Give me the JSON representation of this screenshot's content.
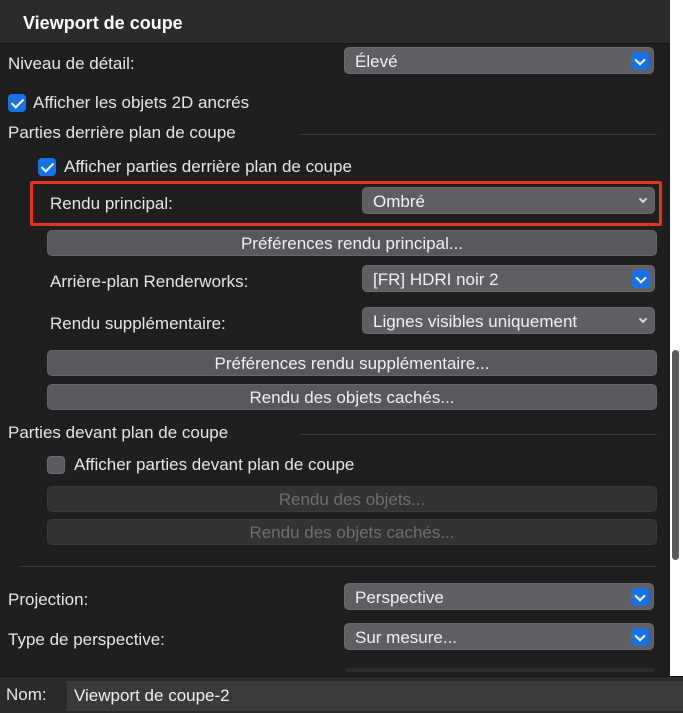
{
  "header": {
    "title": "Viewport de coupe"
  },
  "detail": {
    "label": "Niveau de détail:",
    "value": "Élevé"
  },
  "show_2d": {
    "label": "Afficher les objets 2D ancrés",
    "checked": true
  },
  "behind": {
    "section_label": "Parties derrière plan de coupe",
    "show": {
      "label": "Afficher parties derrière plan de coupe",
      "checked": true
    },
    "main_render": {
      "label": "Rendu principal:",
      "value": "Ombré"
    },
    "main_prefs_button": "Préférences rendu principal...",
    "background": {
      "label": "Arrière-plan Renderworks:",
      "value": "[FR] HDRI noir 2"
    },
    "extra_render": {
      "label": "Rendu supplémentaire:",
      "value": "Lignes visibles uniquement"
    },
    "extra_prefs_button": "Préférences rendu supplémentaire...",
    "hidden_button": "Rendu des objets cachés..."
  },
  "front": {
    "section_label": "Parties devant plan de coupe",
    "show": {
      "label": "Afficher parties devant plan de coupe",
      "checked": false
    },
    "objects_button": "Rendu des objets...",
    "hidden_button": "Rendu des objets cachés..."
  },
  "projection": {
    "label": "Projection:",
    "value": "Perspective"
  },
  "perspective_type": {
    "label": "Type de perspective:",
    "value": "Sur mesure..."
  },
  "footer": {
    "name_label": "Nom:",
    "name_value": "Viewport de coupe-2"
  },
  "colors": {
    "accent": "#1672e6",
    "highlight": "#e8321f",
    "panel_bg": "#1f1f1f"
  },
  "icons": {
    "checkbox": "check-icon",
    "dropdown": "chevron-down-icon"
  }
}
